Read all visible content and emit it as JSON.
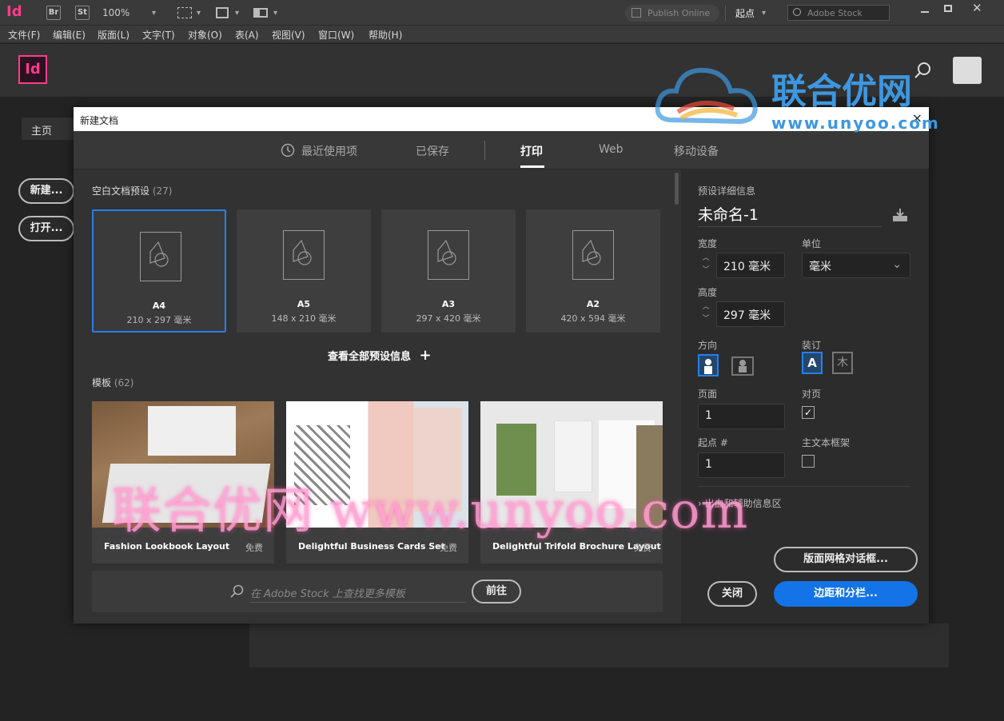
{
  "appbar": {
    "logo": "Id",
    "bridge": "Br",
    "stock_btn": "St",
    "zoom": "100%",
    "publish_online": "Publish Online",
    "workspace": "起点",
    "search_placeholder": "Adobe Stock"
  },
  "menu": [
    "文件(F)",
    "编辑(E)",
    "版面(L)",
    "文字(T)",
    "对象(O)",
    "表(A)",
    "视图(V)",
    "窗口(W)",
    "帮助(H)"
  ],
  "home": {
    "logo": "Id",
    "tab_home": "主页",
    "new_btn": "新建...",
    "open_btn": "打开..."
  },
  "dialog": {
    "title": "新建文档",
    "close": "×",
    "tabs": [
      {
        "label": "最近使用项"
      },
      {
        "label": "已保存"
      },
      {
        "label": "打印"
      },
      {
        "label": "Web"
      },
      {
        "label": "移动设备"
      }
    ],
    "presets_title": "空白文档预设",
    "presets_count": "(27)",
    "presets": [
      {
        "name": "A4",
        "size": "210 x 297 毫米"
      },
      {
        "name": "A5",
        "size": "148 x 210 毫米"
      },
      {
        "name": "A3",
        "size": "297 x 420 毫米"
      },
      {
        "name": "A2",
        "size": "420 x 594 毫米"
      }
    ],
    "view_all": "查看全部预设信息",
    "templates_title": "模板",
    "templates_count": "(62)",
    "templates": [
      {
        "name": "Fashion Lookbook Layout",
        "price": "免费"
      },
      {
        "name": "Delightful Business Cards Set",
        "price": "免费"
      },
      {
        "name": "Delightful Trifold Brochure Layout",
        "price": "免费"
      }
    ],
    "stock_search_placeholder": "在 Adobe Stock 上查找更多模板",
    "go_btn": "前往"
  },
  "details": {
    "title": "预设详细信息",
    "doc_name": "未命名-1",
    "width_label": "宽度",
    "width_value": "210 毫米",
    "unit_label": "单位",
    "unit_value": "毫米",
    "height_label": "高度",
    "height_value": "297 毫米",
    "orientation_label": "方向",
    "binding_label": "装订",
    "pages_label": "页面",
    "pages_value": "1",
    "facing_label": "对页",
    "start_label": "起点 #",
    "start_value": "1",
    "primary_frame_label": "主文本框架",
    "bleed_label": "出血和辅助信息区",
    "layout_grid_btn": "版面网格对话框...",
    "close_btn": "关闭",
    "margins_btn": "边距和分栏..."
  },
  "watermark": {
    "logo": "联合优网",
    "url": "www.unyoo.com",
    "overlay": "联合优网 www.unyoo.com"
  }
}
